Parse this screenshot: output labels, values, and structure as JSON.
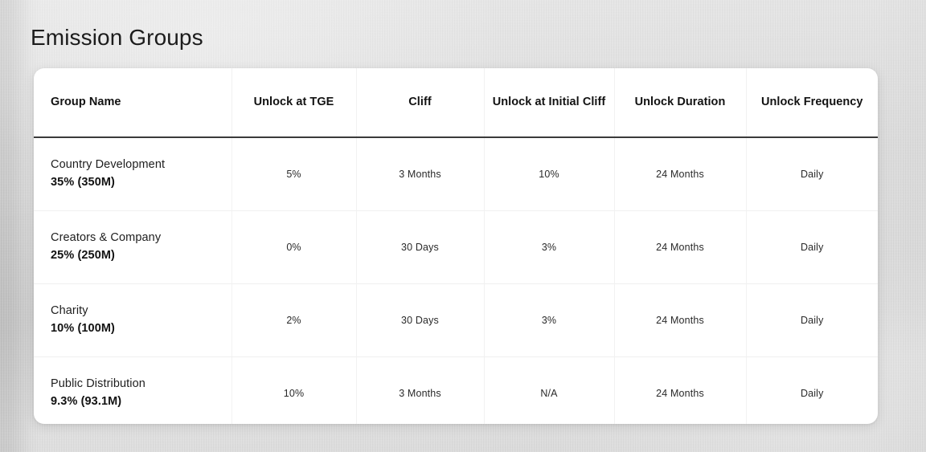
{
  "page": {
    "title": "Emission Groups",
    "background_color": "#dcdcdc",
    "card_color": "#ffffff"
  },
  "table": {
    "columns": [
      {
        "key": "group_name",
        "label": "Group Name"
      },
      {
        "key": "unlock_tge",
        "label": "Unlock at TGE"
      },
      {
        "key": "cliff",
        "label": "Cliff"
      },
      {
        "key": "unlock_init",
        "label": "Unlock at Initial\nCliff"
      },
      {
        "key": "duration",
        "label": "Unlock\nDuration"
      },
      {
        "key": "frequency",
        "label": "Unlock\nFrequency"
      }
    ],
    "rows": [
      {
        "group_name": "Country Development",
        "group_allocation": "35% (350M)",
        "unlock_tge": "5%",
        "cliff": "3 Months",
        "unlock_init": "10%",
        "duration": "24 Months",
        "frequency": "Daily"
      },
      {
        "group_name": "Creators & Company",
        "group_allocation": "25% (250M)",
        "unlock_tge": "0%",
        "cliff": "30 Days",
        "unlock_init": "3%",
        "duration": "24 Months",
        "frequency": "Daily"
      },
      {
        "group_name": "Charity",
        "group_allocation": "10% (100M)",
        "unlock_tge": "2%",
        "cliff": "30 Days",
        "unlock_init": "3%",
        "duration": "24 Months",
        "frequency": "Daily"
      },
      {
        "group_name": "Public Distribution",
        "group_allocation": "9.3% (93.1M)",
        "unlock_tge": "10%",
        "cliff": "3 Months",
        "unlock_init": "N/A",
        "duration": "24 Months",
        "frequency": "Daily"
      }
    ]
  }
}
